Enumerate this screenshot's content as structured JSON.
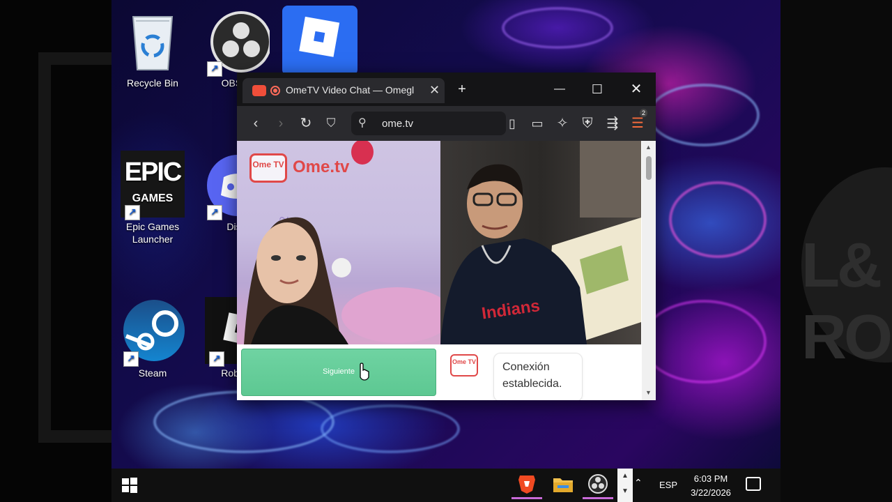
{
  "desktop": {
    "icons": [
      {
        "label": "Recycle Bin"
      },
      {
        "label": "OBS S"
      },
      {
        "label": "Epic Games\nLauncher"
      },
      {
        "label": "Disc"
      },
      {
        "label": "Steam"
      },
      {
        "label": "Roblox"
      }
    ],
    "epic_logo_text_1": "EPIC",
    "epic_logo_text_2": "GAMES"
  },
  "browser": {
    "tab_title": "OmeTV Video Chat — Omegl",
    "tab_close": "✕",
    "new_tab": "+",
    "url": "ome.tv",
    "window_controls": {
      "minimize": "—",
      "maximize": "☐",
      "close": "✕"
    },
    "badge_count": "2"
  },
  "page": {
    "logo_tv": "Ome TV",
    "logo_name": "Ome.tv",
    "next_button": "Siguiente",
    "chat_logo": "Ome TV",
    "chat_message": "Conexión establecida."
  },
  "taskbar": {
    "language": "ESP",
    "time": "6:03 PM",
    "date": "3/22/2026"
  }
}
